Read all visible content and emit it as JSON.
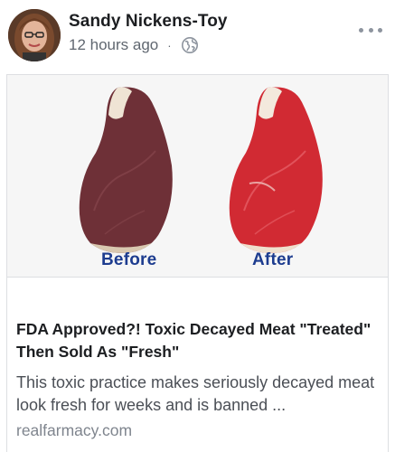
{
  "post": {
    "author": "Sandy Nickens-Toy",
    "timestamp": "12 hours ago",
    "separator": "·",
    "privacy_icon": "globe-icon",
    "more_icon": "more-options-icon"
  },
  "link": {
    "image": {
      "before_label": "Before",
      "after_label": "After"
    },
    "title": "FDA Approved?! Toxic Decayed Meat \"Treated\" Then Sold As \"Fresh\"",
    "description": "This toxic practice makes seriously decayed meat look fresh for weeks and is banned ...",
    "domain": "realfarmacy.com"
  },
  "colors": {
    "label_blue": "#1d3c8f",
    "before_meat": "#6e3037",
    "after_meat": "#d12a33",
    "secondary_text": "#606770"
  }
}
